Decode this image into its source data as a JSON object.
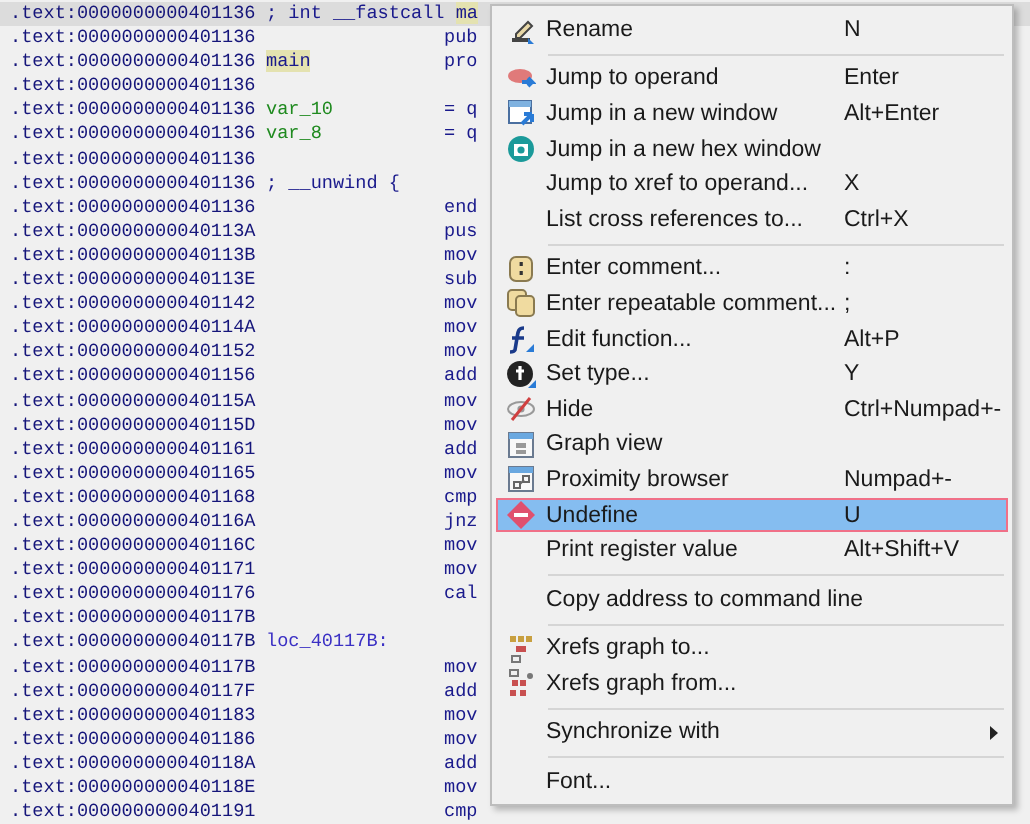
{
  "listing": {
    "rows": [
      {
        "address": ".text:0000000000401136",
        "selected": true,
        "tokens": [
          {
            "text": "; int __fastcall ",
            "kind": "comment",
            "highlighted": false
          },
          {
            "text": "ma",
            "kind": "name",
            "highlighted": true
          }
        ],
        "mnemonic": ""
      },
      {
        "address": ".text:0000000000401136",
        "selected": false,
        "tokens": [],
        "mnemonic": "pub"
      },
      {
        "address": ".text:0000000000401136",
        "selected": false,
        "tokens": [
          {
            "text": "main",
            "kind": "name",
            "highlighted": true
          }
        ],
        "mnemonic": "pro"
      },
      {
        "address": ".text:0000000000401136",
        "selected": false,
        "tokens": [],
        "mnemonic": ""
      },
      {
        "address": ".text:0000000000401136",
        "selected": false,
        "tokens": [
          {
            "text": "var_10",
            "kind": "var",
            "highlighted": false
          }
        ],
        "mnemonic": "= q"
      },
      {
        "address": ".text:0000000000401136",
        "selected": false,
        "tokens": [
          {
            "text": "var_8",
            "kind": "var",
            "highlighted": false
          }
        ],
        "mnemonic": "= q"
      },
      {
        "address": ".text:0000000000401136",
        "selected": false,
        "tokens": [],
        "mnemonic": ""
      },
      {
        "address": ".text:0000000000401136",
        "selected": false,
        "tokens": [
          {
            "text": "; __unwind {",
            "kind": "comment",
            "highlighted": false
          }
        ],
        "mnemonic": ""
      },
      {
        "address": ".text:0000000000401136",
        "selected": false,
        "tokens": [],
        "mnemonic": "end"
      },
      {
        "address": ".text:000000000040113A",
        "selected": false,
        "tokens": [],
        "mnemonic": "pus"
      },
      {
        "address": ".text:000000000040113B",
        "selected": false,
        "tokens": [],
        "mnemonic": "mov"
      },
      {
        "address": ".text:000000000040113E",
        "selected": false,
        "tokens": [],
        "mnemonic": "sub"
      },
      {
        "address": ".text:0000000000401142",
        "selected": false,
        "tokens": [],
        "mnemonic": "mov"
      },
      {
        "address": ".text:000000000040114A",
        "selected": false,
        "tokens": [],
        "mnemonic": "mov"
      },
      {
        "address": ".text:0000000000401152",
        "selected": false,
        "tokens": [],
        "mnemonic": "mov"
      },
      {
        "address": ".text:0000000000401156",
        "selected": false,
        "tokens": [],
        "mnemonic": "add"
      },
      {
        "address": ".text:000000000040115A",
        "selected": false,
        "tokens": [],
        "mnemonic": "mov"
      },
      {
        "address": ".text:000000000040115D",
        "selected": false,
        "tokens": [],
        "mnemonic": "mov"
      },
      {
        "address": ".text:0000000000401161",
        "selected": false,
        "tokens": [],
        "mnemonic": "add"
      },
      {
        "address": ".text:0000000000401165",
        "selected": false,
        "tokens": [],
        "mnemonic": "mov"
      },
      {
        "address": ".text:0000000000401168",
        "selected": false,
        "tokens": [],
        "mnemonic": "cmp"
      },
      {
        "address": ".text:000000000040116A",
        "selected": false,
        "tokens": [],
        "mnemonic": "jnz"
      },
      {
        "address": ".text:000000000040116C",
        "selected": false,
        "tokens": [],
        "mnemonic": "mov"
      },
      {
        "address": ".text:0000000000401171",
        "selected": false,
        "tokens": [],
        "mnemonic": "mov"
      },
      {
        "address": ".text:0000000000401176",
        "selected": false,
        "tokens": [],
        "mnemonic": "cal"
      },
      {
        "address": ".text:000000000040117B",
        "selected": false,
        "tokens": [],
        "mnemonic": ""
      },
      {
        "address": ".text:000000000040117B",
        "selected": false,
        "tokens": [
          {
            "text": "loc_40117B:",
            "kind": "loc",
            "highlighted": false
          }
        ],
        "mnemonic": ""
      },
      {
        "address": ".text:000000000040117B",
        "selected": false,
        "tokens": [],
        "mnemonic": "mov"
      },
      {
        "address": ".text:000000000040117F",
        "selected": false,
        "tokens": [],
        "mnemonic": "add"
      },
      {
        "address": ".text:0000000000401183",
        "selected": false,
        "tokens": [],
        "mnemonic": "mov"
      },
      {
        "address": ".text:0000000000401186",
        "selected": false,
        "tokens": [],
        "mnemonic": "mov"
      },
      {
        "address": ".text:000000000040118A",
        "selected": false,
        "tokens": [],
        "mnemonic": "add"
      },
      {
        "address": ".text:000000000040118E",
        "selected": false,
        "tokens": [],
        "mnemonic": "mov"
      },
      {
        "address": ".text:0000000000401191",
        "selected": false,
        "tokens": [],
        "mnemonic": "cmp"
      }
    ]
  },
  "context_menu": {
    "items": [
      {
        "kind": "item",
        "label": "Rename",
        "shortcut": "N",
        "selected": false
      },
      {
        "kind": "separator"
      },
      {
        "kind": "item",
        "label": "Jump to operand",
        "shortcut": "Enter",
        "selected": false
      },
      {
        "kind": "item",
        "label": "Jump in a new window",
        "shortcut": "Alt+Enter",
        "selected": false
      },
      {
        "kind": "item",
        "label": "Jump in a new hex window",
        "selected": false
      },
      {
        "kind": "item",
        "label": "Jump to xref to operand...",
        "shortcut": "X",
        "selected": false
      },
      {
        "kind": "item",
        "label": "List cross references to...",
        "shortcut": "Ctrl+X",
        "selected": false
      },
      {
        "kind": "separator"
      },
      {
        "kind": "item",
        "label": "Enter comment...",
        "shortcut": ":",
        "selected": false
      },
      {
        "kind": "item",
        "label": "Enter repeatable comment...",
        "shortcut": ";",
        "selected": false
      },
      {
        "kind": "item",
        "label": "Edit function...",
        "shortcut": "Alt+P",
        "selected": false
      },
      {
        "kind": "item",
        "label": "Set type...",
        "shortcut": "Y",
        "selected": false
      },
      {
        "kind": "item",
        "label": "Hide",
        "shortcut": "Ctrl+Numpad+-",
        "selected": false
      },
      {
        "kind": "item",
        "label": "Graph view",
        "selected": false
      },
      {
        "kind": "item",
        "label": "Proximity browser",
        "shortcut": "Numpad+-",
        "selected": false
      },
      {
        "kind": "item",
        "label": "Undefine",
        "shortcut": "U",
        "selected": true
      },
      {
        "kind": "item",
        "label": "Print register value",
        "shortcut": "Alt+Shift+V",
        "selected": false
      },
      {
        "kind": "separator"
      },
      {
        "kind": "item",
        "label": "Copy address to command line",
        "selected": false
      },
      {
        "kind": "separator"
      },
      {
        "kind": "item",
        "label": "Xrefs graph to...",
        "selected": false
      },
      {
        "kind": "item",
        "label": "Xrefs graph from...",
        "selected": false
      },
      {
        "kind": "separator"
      },
      {
        "kind": "item",
        "label": "Synchronize with",
        "selected": false,
        "submenu": true
      },
      {
        "kind": "separator"
      },
      {
        "kind": "item",
        "label": "Font...",
        "selected": false
      }
    ]
  }
}
